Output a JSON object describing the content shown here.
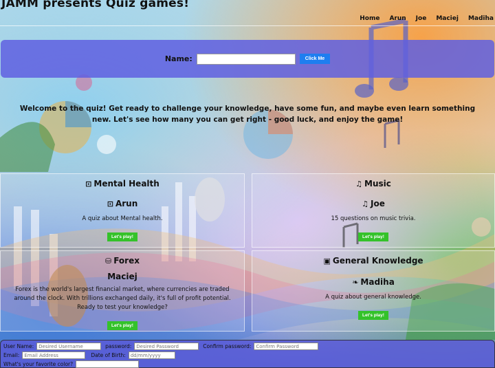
{
  "header": {
    "title": "JAMM presents Quiz games!",
    "nav": [
      "Home",
      "Arun",
      "Joe",
      "Maciej",
      "Madiha"
    ]
  },
  "name_bar": {
    "label": "Name:",
    "input_value": "",
    "button_label": "Click Me"
  },
  "welcome_text": "Welcome to the quiz! Get ready to challenge your knowledge, have some fun, and maybe even learn something new. Let's see how many you can get right - good luck, and enjoy the game!",
  "cards": [
    {
      "category": "Mental Health",
      "category_icon": "brain-icon",
      "author": "Arun",
      "author_icon": "brain-icon",
      "description": "A quiz about Mental health.",
      "button": "Let's play!"
    },
    {
      "category": "Music",
      "category_icon": "music-note-icon",
      "author": "Joe",
      "author_icon": "music-note-icon",
      "description": "15 questions on music trivia.",
      "button": "Let's play!"
    },
    {
      "category": "Forex",
      "category_icon": "money-icon",
      "author": "Maciej",
      "description": "Forex is the world's largest financial market, where currencies are traded around the clock. With trillions exchanged daily, it's full of profit potential. Ready to test your knowledge?",
      "button": "Let's play!"
    },
    {
      "category": "General Knowledge",
      "category_icon": "book-icon",
      "author": "Madiha",
      "author_icon": "leaf-icon",
      "description": "A quiz about general knowledge.",
      "button": "Let's play!"
    }
  ],
  "signup": {
    "username_label": "User Name:",
    "username_placeholder": "Desired Username",
    "password_label": "password:",
    "password_placeholder": "Desired Password",
    "confirm_label": "Confirm password:",
    "confirm_placeholder": "Confirm Password",
    "email_label": "Email:",
    "email_placeholder": "Email Address",
    "dob_label": "Date of Birth:",
    "dob_placeholder": "dd/mm/yyyy",
    "color_label": "What's your favorite color?"
  },
  "colors": {
    "bar_blue": "#5f5fe1",
    "button_blue": "#1e7ef0",
    "play_green": "#34c22a"
  }
}
